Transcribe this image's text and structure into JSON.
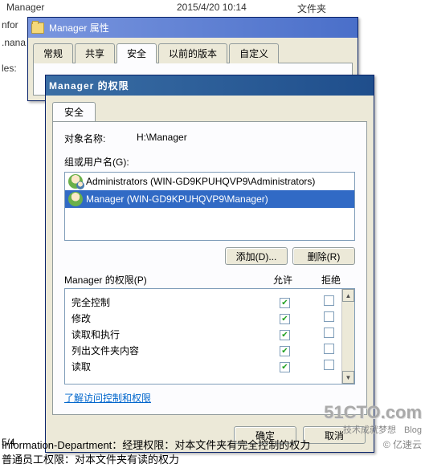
{
  "background": {
    "folder_name": "Manager",
    "date": "2015/4/20 10:14",
    "type_label": "文件夹",
    "left_items": [
      "nfor",
      ".nana",
      "les:"
    ],
    "page": "5/4"
  },
  "dialog1": {
    "title": "Manager 属性",
    "tabs": [
      "常规",
      "共享",
      "安全",
      "以前的版本",
      "自定义"
    ],
    "active_tab_index": 2
  },
  "dialog2": {
    "title": "Manager 的权限",
    "tab": "安全",
    "object_label": "对象名称:",
    "object_value": "H:\\Manager",
    "group_label": "组或用户名(G):",
    "users": [
      {
        "name": "Administrators (WIN-GD9KPUHQVP9\\Administrators)",
        "multi": true
      },
      {
        "name": "Manager (WIN-GD9KPUHQVP9\\Manager)",
        "multi": false
      }
    ],
    "selected_user_index": 1,
    "add_btn": "添加(D)...",
    "remove_btn": "删除(R)",
    "perm_title": "Manager 的权限(P)",
    "allow_label": "允许",
    "deny_label": "拒绝",
    "permissions": [
      {
        "name": "完全控制",
        "allow": true,
        "deny": false
      },
      {
        "name": "修改",
        "allow": true,
        "deny": false
      },
      {
        "name": "读取和执行",
        "allow": true,
        "deny": false
      },
      {
        "name": "列出文件夹内容",
        "allow": true,
        "deny": false
      },
      {
        "name": "读取",
        "allow": true,
        "deny": false
      }
    ],
    "link": "了解访问控制和权限",
    "ok_btn": "确定",
    "cancel_btn": "取消"
  },
  "footer": {
    "line1": "Information-Department：经理权限：对本文件夹有完全控制的权力",
    "line2": "普通员工权限：对本文件夹有读的权力"
  },
  "watermark": {
    "big": "51CTO.com",
    "sm1": "技术成就梦想",
    "sm2": "Blog",
    "cloud": "© 亿速云"
  }
}
